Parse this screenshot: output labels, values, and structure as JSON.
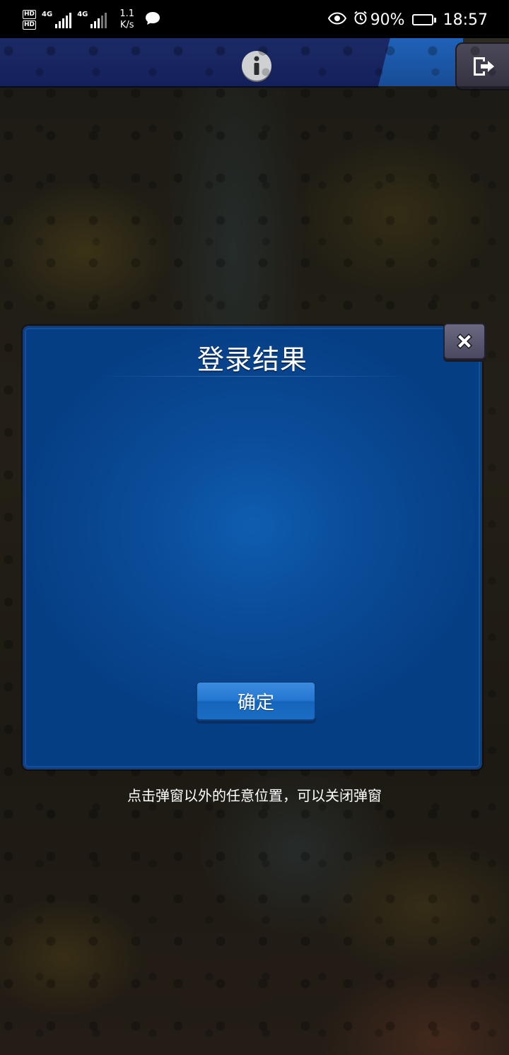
{
  "status_bar": {
    "hd1": "HD",
    "hd2": "HD",
    "sim1_tech": "4G",
    "sim2_tech": "4G",
    "net_speed_value": "1.1",
    "net_speed_unit": "K/s",
    "battery_percent": "90%",
    "battery_level": 0.9,
    "time": "18:57"
  },
  "dialog": {
    "title": "登录结果",
    "confirm_label": "确定"
  },
  "hint": "点击弹窗以外的任意位置，可以关闭弹窗"
}
